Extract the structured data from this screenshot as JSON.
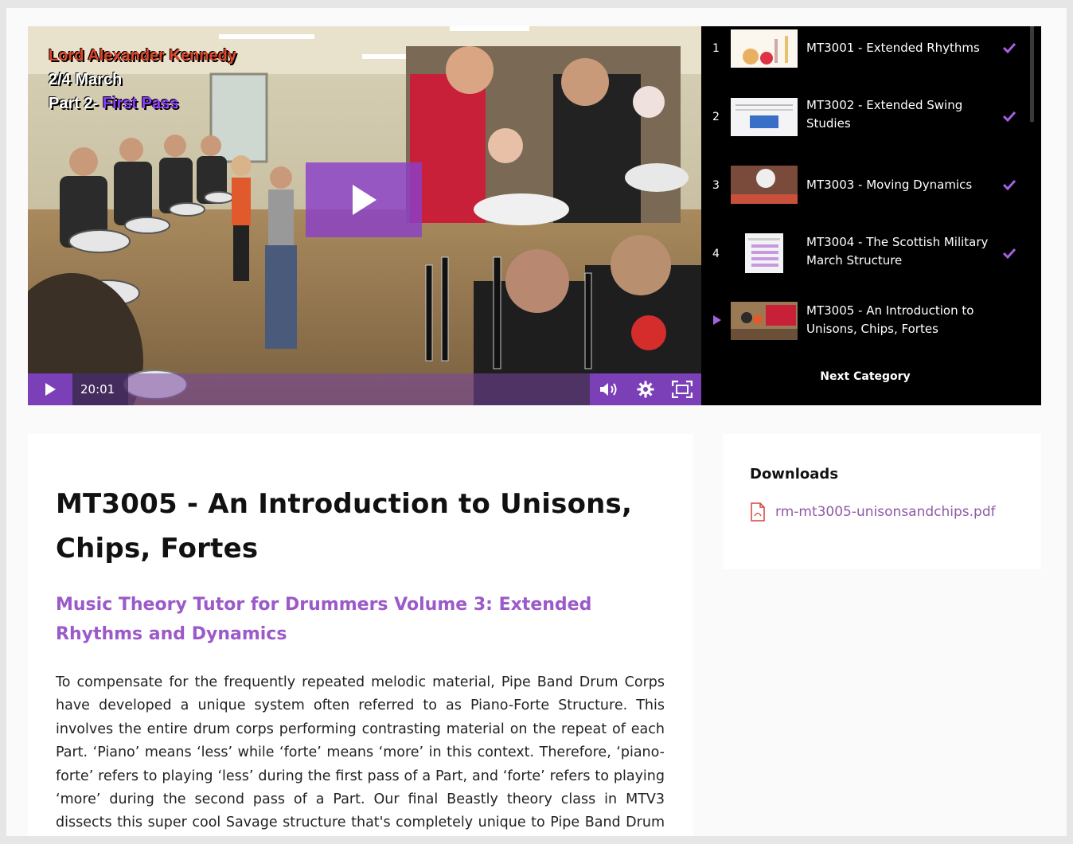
{
  "video": {
    "overlay_line1": "Lord Alexander Kennedy",
    "overlay_line2": "2/4 March",
    "overlay_line3_prefix": "Part 2- ",
    "overlay_line3_highlight": "First Pass",
    "time": "20:01",
    "accent_color": "#7b3fb8"
  },
  "playlist": {
    "items": [
      {
        "num": "1",
        "title": "MT3001 - Extended Rhythms",
        "completed": true
      },
      {
        "num": "2",
        "title": "MT3002 - Extended Swing Studies",
        "completed": true
      },
      {
        "num": "3",
        "title": "MT3003 - Moving Dynamics",
        "completed": true
      },
      {
        "num": "4",
        "title": "MT3004 - The Scottish Military March Structure",
        "completed": true
      },
      {
        "num": "",
        "title": "MT3005 - An Introduction to Unisons, Chips, Fortes",
        "completed": false,
        "active": true
      }
    ],
    "next_label": "Next Category"
  },
  "lesson": {
    "title": "MT3005 - An Introduction to Unisons, Chips, Fortes",
    "subtitle": "Music Theory Tutor for Drummers Volume 3: Extended Rhythms and Dynamics",
    "body": "To compensate for the frequently repeated melodic material, Pipe Band Drum Corps have developed a unique system often referred to as Piano-Forte Structure. This involves the entire drum corps performing contrasting material on the repeat of each Part. ‘Piano’ means ‘less’ while ‘forte’ means ‘more’ in this context. Therefore, ‘piano-forte’ refers to playing ‘less’ during the first pass of a Part, and ‘forte’ refers to playing ‘more’ during the second pass of a Part. Our final Beastly theory class in MTV3 dissects this super cool Savage structure that's completely unique to Pipe Band Drum Corps."
  },
  "downloads": {
    "heading": "Downloads",
    "file": "rm-mt3005-unisonsandchips.pdf"
  }
}
